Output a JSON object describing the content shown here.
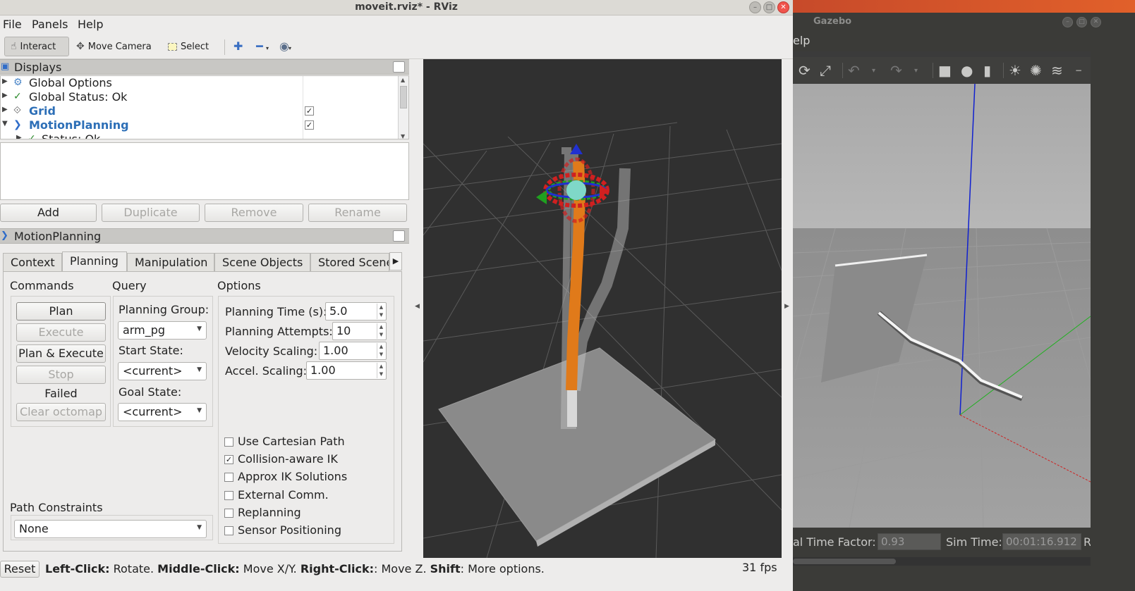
{
  "rviz": {
    "title": "moveit.rviz* - RViz",
    "menu": {
      "file": "File",
      "panels": "Panels",
      "help": "Help"
    },
    "toolbar": {
      "interact": "Interact",
      "move_camera": "Move Camera",
      "select": "Select"
    },
    "displays": {
      "title": "Displays",
      "items": [
        {
          "label": "Global Options"
        },
        {
          "label": "Global Status: Ok"
        },
        {
          "label": "Grid",
          "checked": "✓"
        },
        {
          "label": "MotionPlanning",
          "checked": "✓"
        },
        {
          "label": "Status: Ok"
        }
      ]
    },
    "buttons": {
      "add": "Add",
      "duplicate": "Duplicate",
      "remove": "Remove",
      "rename": "Rename"
    },
    "motion_panel": {
      "title": "MotionPlanning",
      "tabs": [
        "Context",
        "Planning",
        "Manipulation",
        "Scene Objects",
        "Stored Scenes"
      ],
      "active_tab": "Planning",
      "commands": {
        "label": "Commands",
        "plan": "Plan",
        "execute": "Execute",
        "plan_execute": "Plan & Execute",
        "stop": "Stop",
        "status": "Failed",
        "clear_octomap": "Clear octomap"
      },
      "query": {
        "label": "Query",
        "planning_group_label": "Planning Group:",
        "planning_group": "arm_pg",
        "start_state_label": "Start State:",
        "start_state": "<current>",
        "goal_state_label": "Goal State:",
        "goal_state": "<current>"
      },
      "options": {
        "label": "Options",
        "planning_time_label": "Planning Time (s):",
        "planning_time": "5.0",
        "planning_attempts_label": "Planning Attempts:",
        "planning_attempts": "10",
        "velocity_scaling_label": "Velocity Scaling:",
        "velocity_scaling": "1.00",
        "accel_scaling_label": "Accel. Scaling:",
        "accel_scaling": "1.00",
        "checkboxes": [
          {
            "label": "Use Cartesian Path",
            "checked": ""
          },
          {
            "label": "Collision-aware IK",
            "checked": "✓"
          },
          {
            "label": "Approx IK Solutions",
            "checked": ""
          },
          {
            "label": "External Comm.",
            "checked": ""
          },
          {
            "label": "Replanning",
            "checked": ""
          },
          {
            "label": "Sensor Positioning",
            "checked": ""
          }
        ]
      },
      "path_constraints": {
        "label": "Path Constraints",
        "value": "None"
      }
    },
    "statusbar": {
      "reset": "Reset",
      "hint_parts": [
        "Left-Click:",
        " Rotate. ",
        "Middle-Click:",
        " Move X/Y. ",
        "Right-Click:",
        ": Move Z. ",
        "Shift",
        ": More options."
      ],
      "fps": "31 fps"
    },
    "colors": {
      "viewport_bg": "#303030",
      "robot_orange": "#e07a1a",
      "accent_blue": "#2d6fb7"
    }
  },
  "gazebo": {
    "title": "Gazebo",
    "menu_help_fragment": "elp",
    "bottombar": {
      "rtf_label": "al Time Factor:",
      "rtf_value": "0.93",
      "sim_time_label": "Sim Time:",
      "sim_time_value": "00:01:16.912",
      "trailing": "R"
    }
  }
}
